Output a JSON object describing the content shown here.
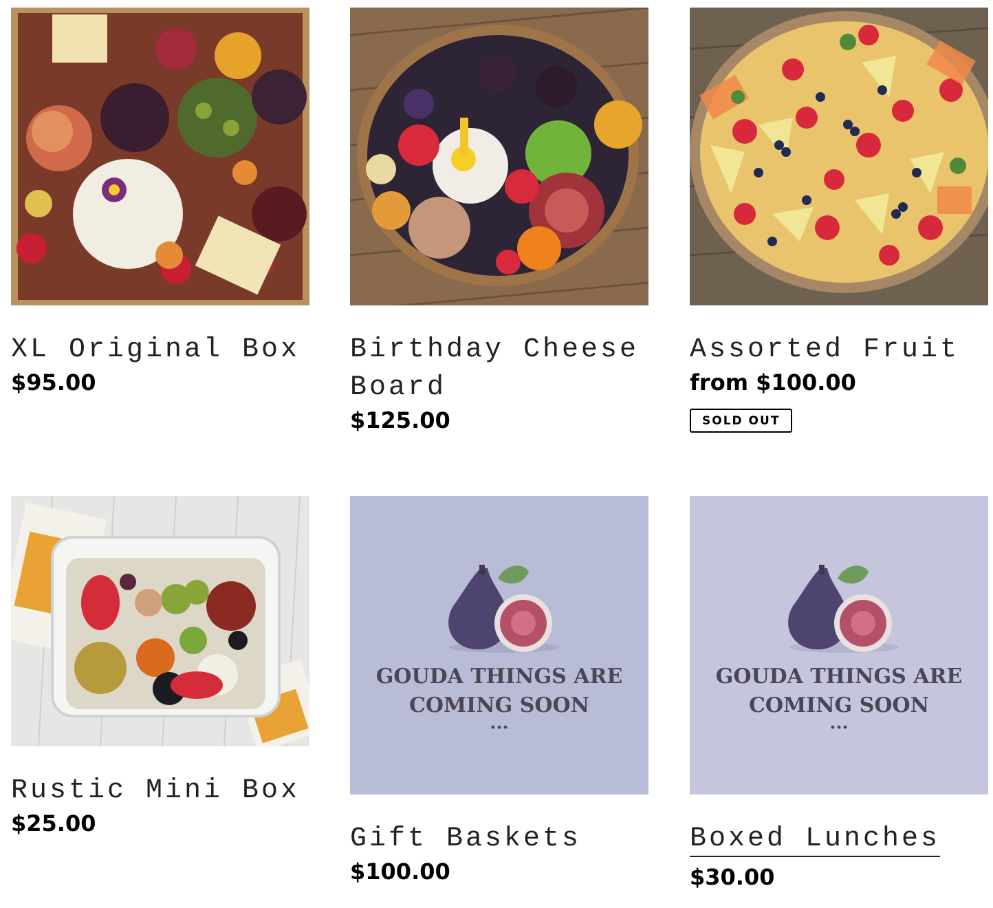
{
  "products": [
    {
      "title": "XL Original Box",
      "price": "$95.00",
      "image": "charcuterie-box-photo"
    },
    {
      "title": "Birthday Cheese Board",
      "price": "$125.00",
      "image": "birthday-board-photo"
    },
    {
      "title": "Assorted Fruit",
      "price": "from $100.00",
      "badge": "SOLD OUT",
      "image": "fruit-platter-photo"
    },
    {
      "title": "Rustic Mini Box",
      "price": "$25.00",
      "image": "mini-box-photo"
    },
    {
      "title": "Gift Baskets",
      "price": "$100.00",
      "image": "coming-soon-placeholder",
      "placeholder_line1": "GOUDA THINGS ARE",
      "placeholder_line2": "COMING SOON",
      "placeholder_dots": "..."
    },
    {
      "title": "Boxed Lunches",
      "price": "$30.00",
      "image": "coming-soon-placeholder",
      "placeholder_line1": "GOUDA THINGS ARE",
      "placeholder_line2": "COMING SOON",
      "placeholder_dots": "..."
    }
  ],
  "colors": {
    "placeholder_bg_1": "#b9bcd6",
    "placeholder_bg_2": "#c5c6dd",
    "fig_purple": "#4d4470",
    "fig_flesh": "#b5506a",
    "leaf_green": "#6f9c5b"
  }
}
